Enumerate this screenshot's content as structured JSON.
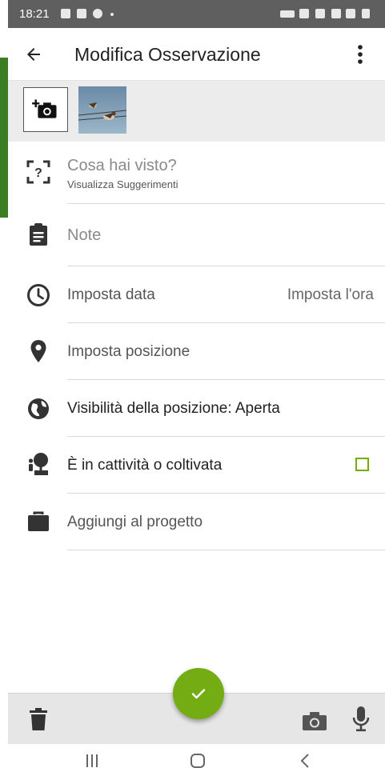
{
  "status_bar": {
    "time": "18:21"
  },
  "app_bar": {
    "title": "Modifica Osservazione"
  },
  "form": {
    "species": {
      "placeholder": "Cosa hai visto?",
      "suggestions_link": "Visualizza Suggerimenti"
    },
    "notes": {
      "placeholder": "Note"
    },
    "date": {
      "label": "Imposta data",
      "time_label": "Imposta l'ora"
    },
    "location": {
      "label": "Imposta posizione"
    },
    "visibility": {
      "label": "Visibilità della posizione: Aperta"
    },
    "captive": {
      "label": "È in cattività o coltivata",
      "checked": false
    },
    "project": {
      "label": "Aggiungi al progetto"
    }
  },
  "colors": {
    "accent": "#74ac00",
    "fab": "#73ac13",
    "status_bar": "#5f5f5f"
  },
  "icons": [
    "back-arrow-icon",
    "more-vert-icon",
    "add-photo-icon",
    "species-question-icon",
    "clipboard-icon",
    "clock-icon",
    "location-pin-icon",
    "globe-icon",
    "captive-plant-icon",
    "briefcase-icon",
    "trash-icon",
    "camera-icon",
    "microphone-icon",
    "check-icon"
  ]
}
